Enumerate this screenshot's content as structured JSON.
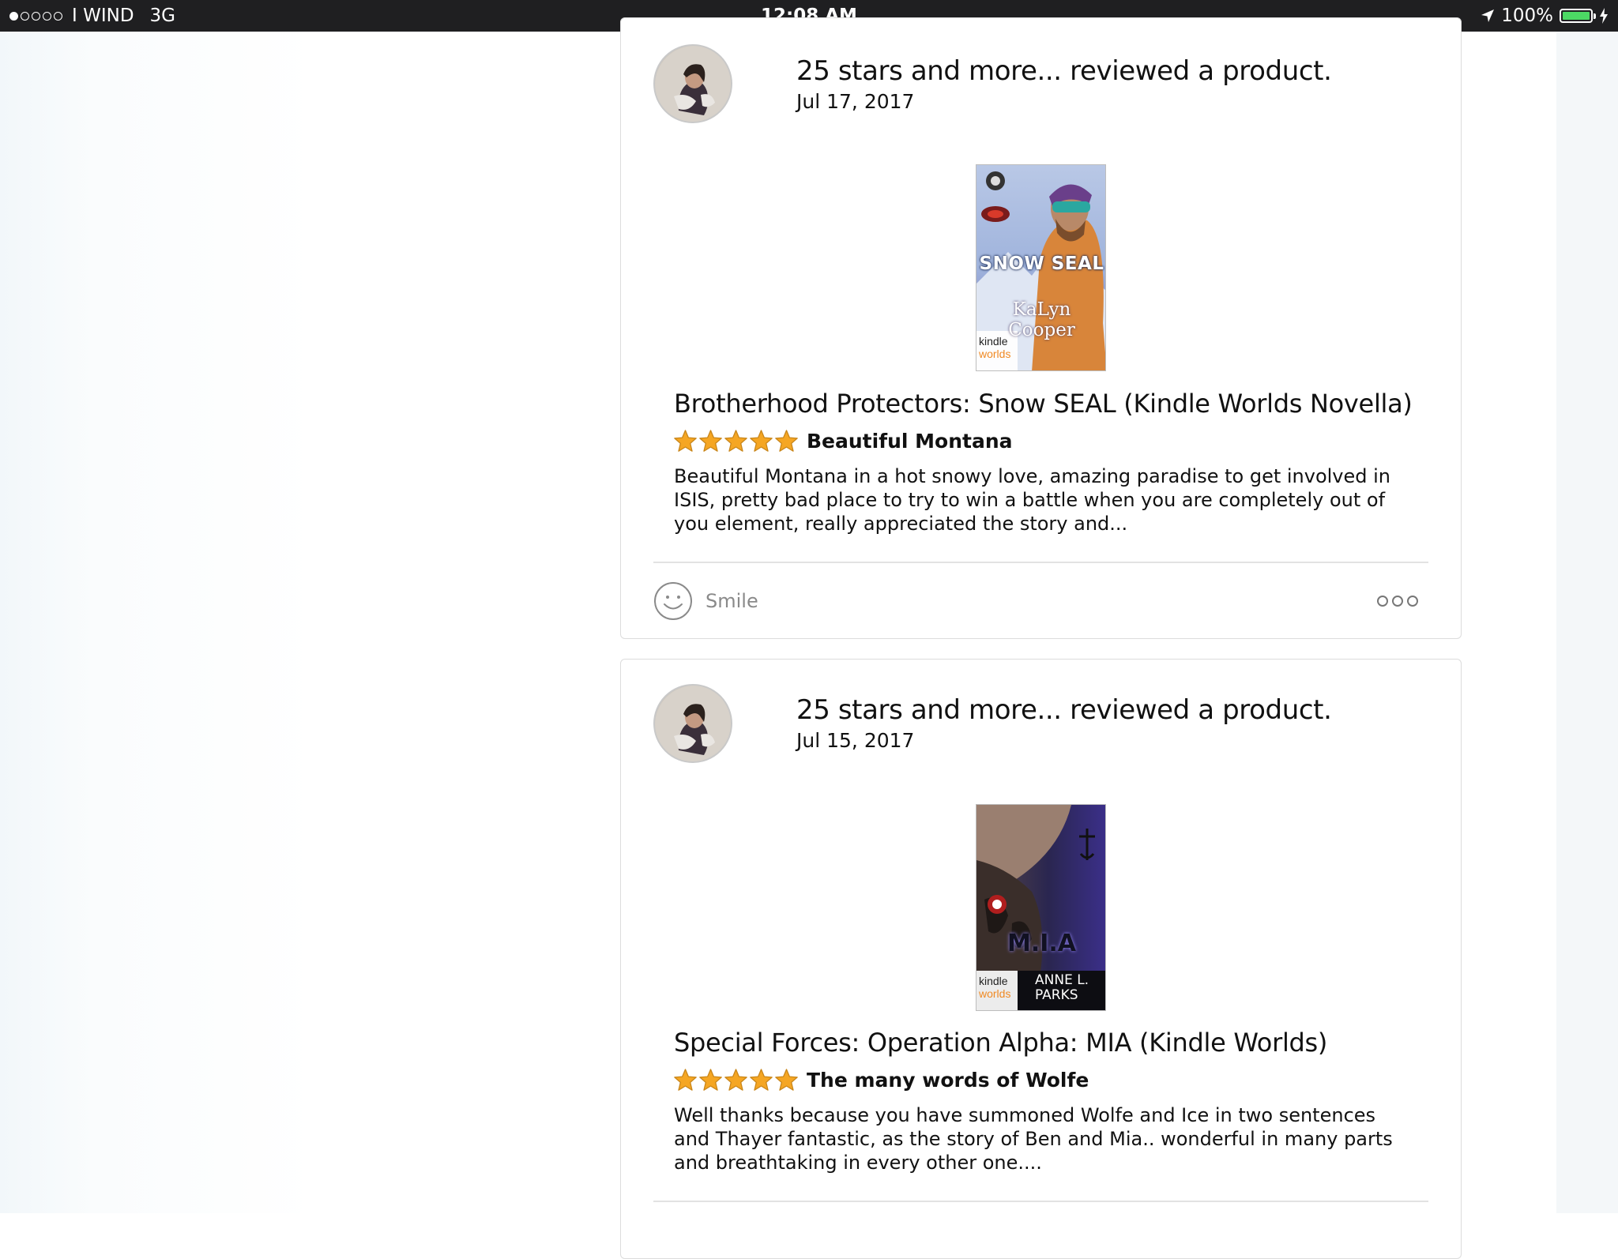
{
  "status_bar": {
    "signal_bars_filled": 1,
    "signal_bars_total": 5,
    "carrier": "I WIND",
    "network": "3G",
    "time": "12:08 AM",
    "battery_percent": "100%",
    "battery_level": 1.0,
    "location_icon": "location-arrow-icon",
    "charging_icon": "charging-bolt-icon"
  },
  "colors": {
    "status_bar_bg": "#1f1f21",
    "battery_green": "#4cd964",
    "star_gold": "#f5a623",
    "muted_text": "#8a8a8a",
    "card_border": "#dcdcdc"
  },
  "feed": {
    "cards": [
      {
        "reviewer_headline": "25 stars and more... reviewed a product.",
        "date": "Jul 17, 2017",
        "cover": {
          "series": "SNOW SEAL",
          "author": "KaLyn Cooper",
          "badge_top": "kindle",
          "badge_bottom": "worlds"
        },
        "product_title": "Brotherhood Protectors: Snow SEAL (Kindle Worlds Novella)",
        "rating": 5,
        "review_title": "Beautiful Montana",
        "review_body": "Beautiful Montana in a hot snowy love, amazing paradise to get involved in ISIS, pretty bad place to try to win a battle when you are completely out of you element, really appreciated the story and...",
        "smile_label": "Smile"
      },
      {
        "reviewer_headline": "25 stars and more... reviewed a product.",
        "date": "Jul 15, 2017",
        "cover": {
          "series": "M.I.A",
          "author_line1": "ANNE L.",
          "author_line2": "PARKS",
          "badge_top": "kindle",
          "badge_bottom": "worlds"
        },
        "product_title": "Special Forces: Operation Alpha: MIA (Kindle Worlds)",
        "rating": 5,
        "review_title": "The many words of Wolfe",
        "review_body": "Well thanks because you have summoned Wolfe and Ice in two sentences and Thayer fantastic, as the story of Ben and Mia.. wonderful in many parts and breathtaking in every other one...."
      }
    ]
  }
}
